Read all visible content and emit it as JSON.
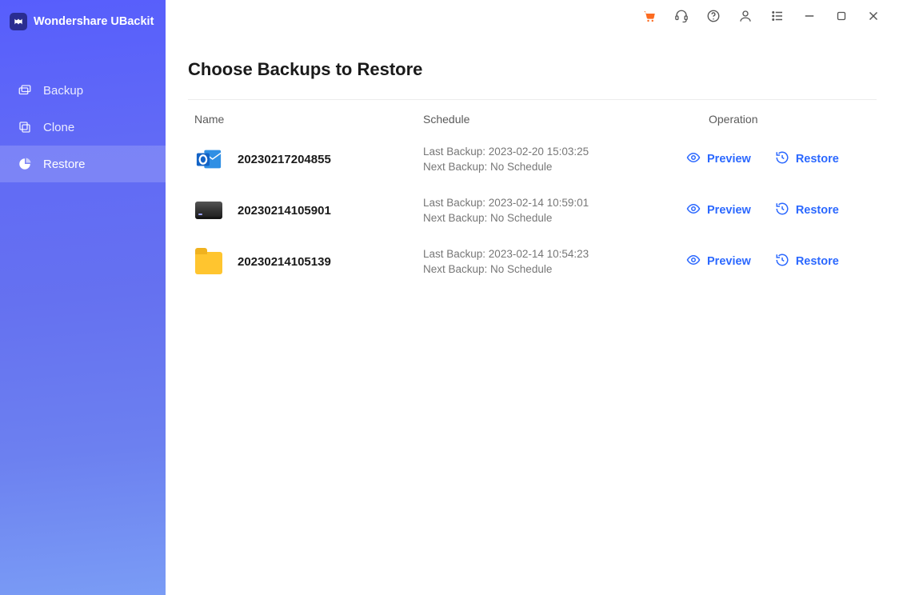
{
  "app_title": "Wondershare UBackit",
  "sidebar": {
    "items": [
      {
        "label": "Backup",
        "icon": "folders-icon"
      },
      {
        "label": "Clone",
        "icon": "copy-icon"
      },
      {
        "label": "Restore",
        "icon": "pie-icon"
      }
    ],
    "active_index": 2
  },
  "page": {
    "title": "Choose Backups to Restore",
    "columns": {
      "name": "Name",
      "schedule": "Schedule",
      "operation": "Operation"
    }
  },
  "labels": {
    "last_backup_prefix": "Last Backup: ",
    "next_backup_prefix": "Next Backup: ",
    "preview": "Preview",
    "restore": "Restore"
  },
  "backups": [
    {
      "name": "20230217204855",
      "type": "outlook",
      "last_backup": "2023-02-20 15:03:25",
      "next_backup": "No Schedule"
    },
    {
      "name": "20230214105901",
      "type": "drive",
      "last_backup": "2023-02-14 10:59:01",
      "next_backup": "No Schedule"
    },
    {
      "name": "20230214105139",
      "type": "folder",
      "last_backup": "2023-02-14 10:54:23",
      "next_backup": "No Schedule"
    }
  ]
}
